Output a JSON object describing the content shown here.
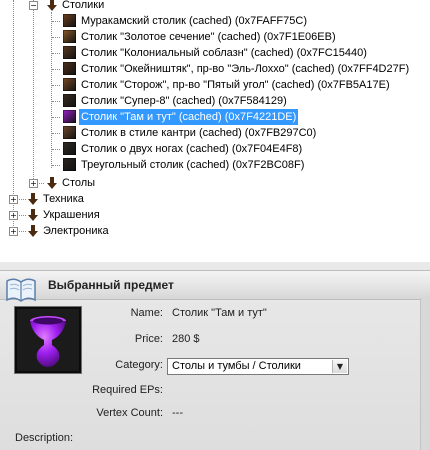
{
  "tree": {
    "stoliki": {
      "label": "Столики",
      "expanded": true
    },
    "items": [
      {
        "label": "Муракамский столик (cached) (0x7FAFF75C)",
        "thumb": "#6b3f1e"
      },
      {
        "label": "Столик \"Золотое сечение\" (cached) (0x7F1E06EB)",
        "thumb": "#8a5a2b"
      },
      {
        "label": "Столик \"Колониальный соблазн\" (cached) (0x7FC15440)",
        "thumb": "#5a3a22"
      },
      {
        "label": "Столик \"Окейништяк\", пр-во \"Эль-Лоххо\" (cached) (0x7FF4D27F)",
        "thumb": "#4e2f1a"
      },
      {
        "label": "Столик \"Сторож\", пр-во \"Пятый угол\" (cached) (0x7FB5A17E)",
        "thumb": "#7a4b26"
      },
      {
        "label": "Столик \"Супер-8\" (cached) (0x7F584129)",
        "thumb": "#3a2c22"
      },
      {
        "label": "Столик \"Там и тут\" (cached) (0x7F4221DE)",
        "thumb": "#9b1ec9",
        "selected": true
      },
      {
        "label": "Столик в стиле кантри (cached) (0x7FB297C0)",
        "thumb": "#6e4a2e"
      },
      {
        "label": "Столик о двух ногах (cached) (0x7F04E4F8)",
        "thumb": "#2f2a26"
      },
      {
        "label": "Треугольный столик (cached) (0x7F2BC08F)",
        "thumb": "#2a241f"
      }
    ],
    "stoly": {
      "label": "Столы",
      "expanded": false
    },
    "root": [
      {
        "label": "Техника",
        "expanded": false
      },
      {
        "label": "Украшения",
        "expanded": false
      },
      {
        "label": "Электроника",
        "expanded": false
      }
    ]
  },
  "panel": {
    "title": "Выбранный предмет",
    "name_label": "Name:",
    "name_value": "Столик \"Там и тут\"",
    "price_label": "Price:",
    "price_value": "280 $",
    "category_label": "Category:",
    "category_value": "Столы и тумбы / Столики",
    "required_eps_label": "Required EPs:",
    "vertex_count_label": "Vertex Count:",
    "vertex_count_value": "---",
    "description_label": "Description:"
  },
  "colors": {
    "selection": "#3399ff",
    "tree_arrow": "#4a2a10",
    "preview_object": "#a020f0"
  }
}
